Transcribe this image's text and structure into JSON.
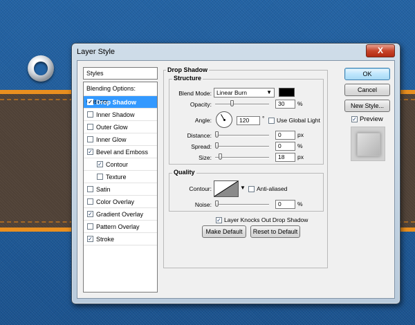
{
  "window": {
    "title": "Layer Style",
    "close_label": "X"
  },
  "styles_panel": {
    "header": "Styles",
    "blending_options": "Blending Options: Custom",
    "items": [
      {
        "label": "Drop Shadow",
        "checked": true,
        "selected": true,
        "sub": false
      },
      {
        "label": "Inner Shadow",
        "checked": false,
        "selected": false,
        "sub": false
      },
      {
        "label": "Outer Glow",
        "checked": false,
        "selected": false,
        "sub": false
      },
      {
        "label": "Inner Glow",
        "checked": false,
        "selected": false,
        "sub": false
      },
      {
        "label": "Bevel and Emboss",
        "checked": true,
        "selected": false,
        "sub": false
      },
      {
        "label": "Contour",
        "checked": true,
        "selected": false,
        "sub": true
      },
      {
        "label": "Texture",
        "checked": false,
        "selected": false,
        "sub": true
      },
      {
        "label": "Satin",
        "checked": false,
        "selected": false,
        "sub": false
      },
      {
        "label": "Color Overlay",
        "checked": false,
        "selected": false,
        "sub": false
      },
      {
        "label": "Gradient Overlay",
        "checked": true,
        "selected": false,
        "sub": false
      },
      {
        "label": "Pattern Overlay",
        "checked": false,
        "selected": false,
        "sub": false
      },
      {
        "label": "Stroke",
        "checked": true,
        "selected": false,
        "sub": false
      }
    ]
  },
  "drop_shadow": {
    "title": "Drop Shadow",
    "structure": {
      "title": "Structure",
      "blend_mode_label": "Blend Mode:",
      "blend_mode_value": "Linear Burn",
      "shadow_color": "#000000",
      "opacity_label": "Opacity:",
      "opacity_value": "30",
      "opacity_unit": "%",
      "opacity_level": 30,
      "angle_label": "Angle:",
      "angle_value": "120",
      "angle_unit": "°",
      "use_global_light_label": "Use Global Light",
      "use_global_light_checked": false,
      "distance_label": "Distance:",
      "distance_value": "0",
      "distance_unit": "px",
      "distance_level": 0,
      "spread_label": "Spread:",
      "spread_value": "0",
      "spread_unit": "%",
      "spread_level": 0,
      "size_label": "Size:",
      "size_value": "18",
      "size_unit": "px",
      "size_level": 7
    },
    "quality": {
      "title": "Quality",
      "contour_label": "Contour:",
      "anti_aliased_label": "Anti-aliased",
      "anti_aliased_checked": false,
      "noise_label": "Noise:",
      "noise_value": "0",
      "noise_unit": "%",
      "noise_level": 0
    },
    "knocks_out_label": "Layer Knocks Out Drop Shadow",
    "knocks_out_checked": true,
    "make_default_label": "Make Default",
    "reset_default_label": "Reset to Default"
  },
  "actions": {
    "ok_label": "OK",
    "cancel_label": "Cancel",
    "new_style_label": "New Style...",
    "preview_label": "Preview",
    "preview_checked": true
  }
}
